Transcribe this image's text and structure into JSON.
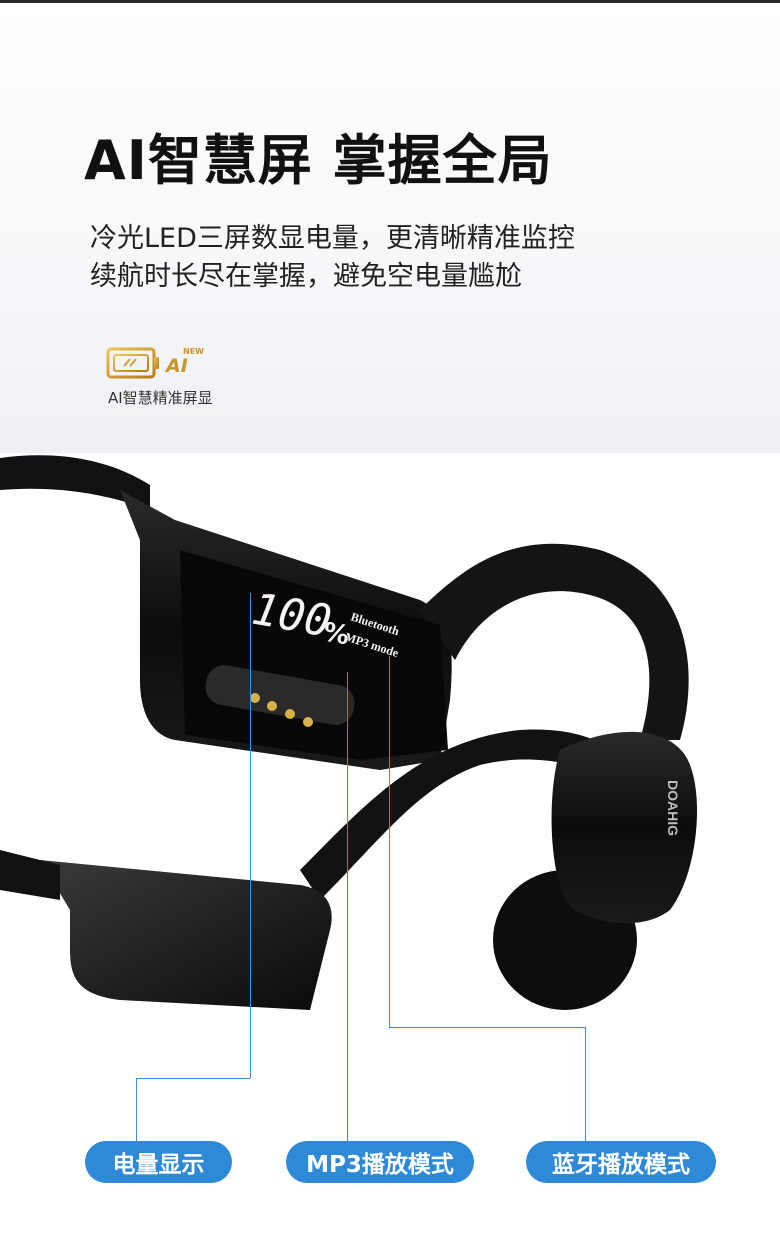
{
  "headline": "AI智慧屏 掌握全局",
  "description": {
    "line1": "冷光LED三屏数显电量，更清晰精准监控",
    "line2": "续航时长尽在掌握，避免空电量尴尬"
  },
  "badge": {
    "icon": "ai-screen-icon",
    "new_label": "NEW",
    "ai_label": "AI",
    "caption": "AI智慧精准屏显"
  },
  "product": {
    "display_percent": "100",
    "display_percent_sign": "%",
    "display_bluetooth": "Bluetooth",
    "display_mode": "MP3 mode",
    "brand": "DOAHIG"
  },
  "callouts": [
    {
      "label": "电量显示"
    },
    {
      "label": "MP3播放模式"
    },
    {
      "label": "蓝牙播放模式"
    }
  ],
  "colors": {
    "accent": "#2e8ad9",
    "gold": "#c7952a",
    "device": "#111111"
  }
}
